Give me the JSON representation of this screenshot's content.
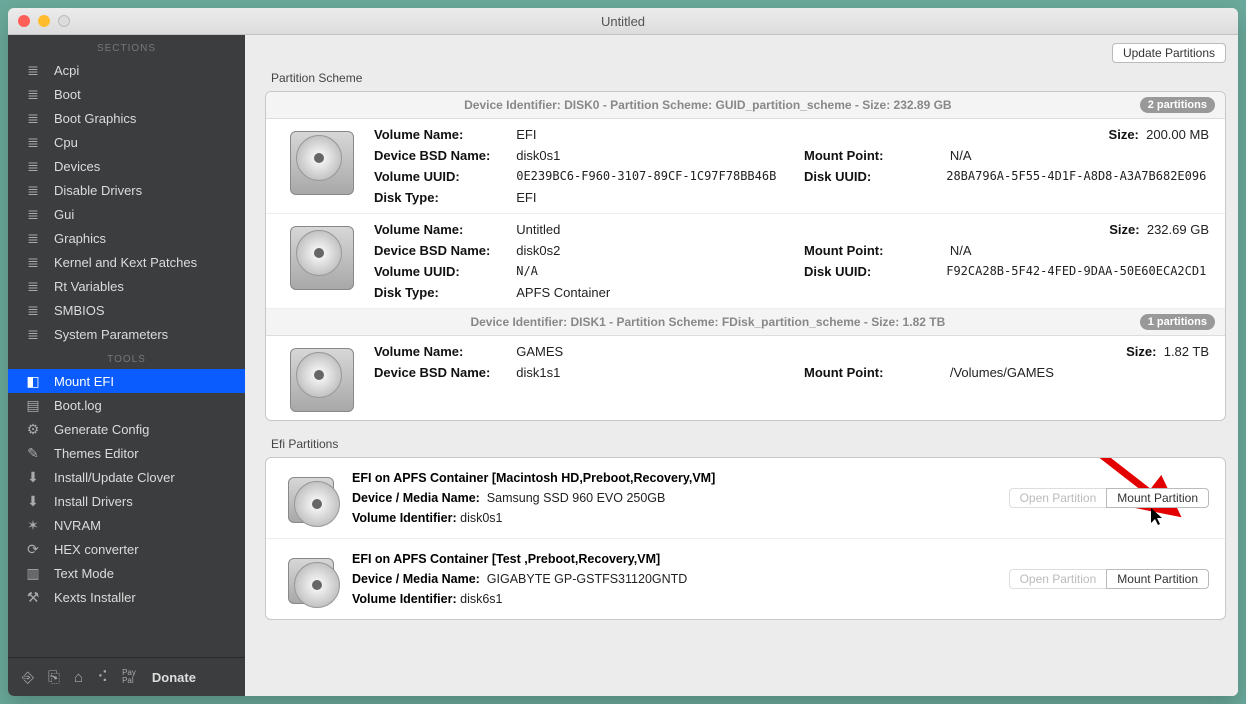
{
  "window": {
    "title": "Untitled"
  },
  "sidebar": {
    "sections_label": "SECTIONS",
    "tools_label": "TOOLS",
    "sections": [
      {
        "label": "Acpi",
        "icon": "≣"
      },
      {
        "label": "Boot",
        "icon": "≣"
      },
      {
        "label": "Boot Graphics",
        "icon": "≣"
      },
      {
        "label": "Cpu",
        "icon": "≣"
      },
      {
        "label": "Devices",
        "icon": "≣"
      },
      {
        "label": "Disable Drivers",
        "icon": "≣"
      },
      {
        "label": "Gui",
        "icon": "≣"
      },
      {
        "label": "Graphics",
        "icon": "≣"
      },
      {
        "label": "Kernel and Kext Patches",
        "icon": "≣"
      },
      {
        "label": "Rt Variables",
        "icon": "≣"
      },
      {
        "label": "SMBIOS",
        "icon": "≣"
      },
      {
        "label": "System Parameters",
        "icon": "≣"
      }
    ],
    "tools": [
      {
        "label": "Mount EFI",
        "icon": "◧",
        "active": true
      },
      {
        "label": "Boot.log",
        "icon": "▤"
      },
      {
        "label": "Generate Config",
        "icon": "⚙"
      },
      {
        "label": "Themes Editor",
        "icon": "✎"
      },
      {
        "label": "Install/Update Clover",
        "icon": "⬇"
      },
      {
        "label": "Install Drivers",
        "icon": "⬇"
      },
      {
        "label": "NVRAM",
        "icon": "✶"
      },
      {
        "label": "HEX converter",
        "icon": "⟳"
      },
      {
        "label": "Text Mode",
        "icon": "▥"
      },
      {
        "label": "Kexts Installer",
        "icon": "⚒"
      }
    ],
    "donate": "Donate"
  },
  "main": {
    "update_btn": "Update Partitions",
    "scheme_title": "Partition Scheme",
    "disks": [
      {
        "header": "Device Identifier: DISK0 - Partition Scheme: GUID_partition_scheme - Size: 232.89 GB",
        "badge": "2 partitions",
        "vols": [
          {
            "name": "EFI",
            "bsd": "disk0s1",
            "uuid": "0E239BC6-F960-3107-89CF-1C97F78BB46B",
            "type": "EFI",
            "size": "200.00 MB",
            "mountpoint": "N/A",
            "diskuuid": "28BA796A-5F55-4D1F-A8D8-A3A7B682E096"
          },
          {
            "name": "Untitled",
            "bsd": "disk0s2",
            "uuid": "N/A",
            "type": "APFS Container",
            "size": "232.69 GB",
            "mountpoint": "N/A",
            "diskuuid": "F92CA28B-5F42-4FED-9DAA-50E60ECA2CD1"
          }
        ]
      },
      {
        "header": "Device Identifier: DISK1 - Partition Scheme: FDisk_partition_scheme - Size: 1.82 TB",
        "badge": "1 partitions",
        "vols": [
          {
            "name": "GAMES",
            "bsd": "disk1s1",
            "uuid": "",
            "type": "",
            "size": "1.82 TB",
            "mountpoint": "/Volumes/GAMES",
            "diskuuid": ""
          }
        ]
      }
    ],
    "efi_title": "Efi Partitions",
    "efis": [
      {
        "title": "EFI on APFS Container [Macintosh HD,Preboot,Recovery,VM]",
        "media": "Samsung SSD 960 EVO 250GB",
        "volid": "disk0s1"
      },
      {
        "title": "EFI on APFS Container [Test ,Preboot,Recovery,VM]",
        "media": "GIGABYTE GP-GSTFS31120GNTD",
        "volid": "disk6s1"
      }
    ],
    "labels": {
      "volname": "Volume Name:",
      "bsd": "Device BSD Name:",
      "vuuid": "Volume UUID:",
      "dtype": "Disk Type:",
      "size": "Size:",
      "mount": "Mount Point:",
      "duuid": "Disk UUID:",
      "devmedia": "Device / Media Name:",
      "volid": "Volume Identifier:",
      "open": "Open Partition",
      "mountbtn": "Mount Partition"
    }
  }
}
